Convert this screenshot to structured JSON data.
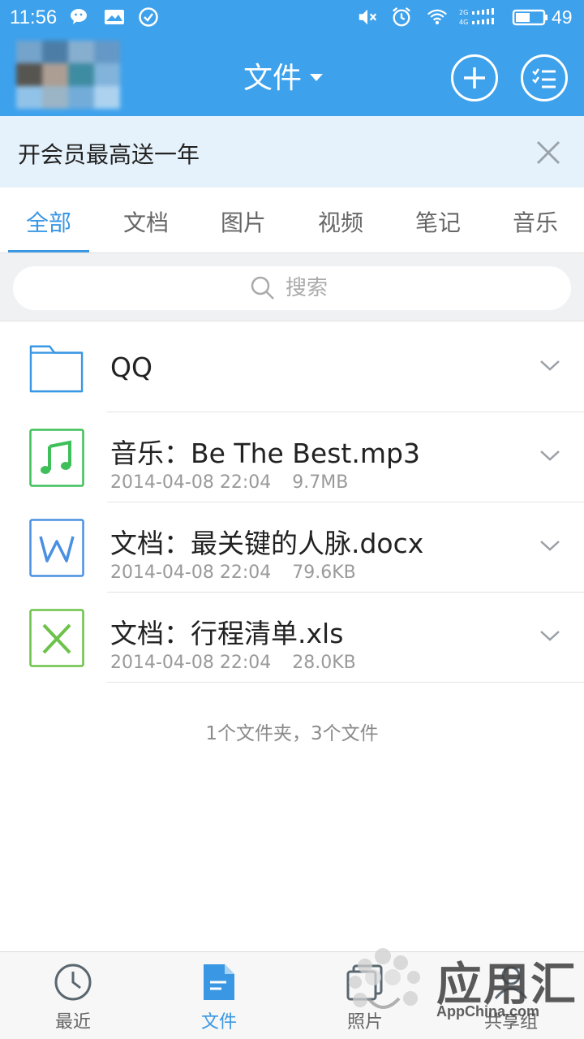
{
  "status_bar": {
    "time": "11:56",
    "battery": "49",
    "network": "2G 4G",
    "icons": [
      "wechat-icon",
      "message-icon",
      "check-circle-icon",
      "mute-icon",
      "alarm-icon",
      "wifi-icon",
      "signal-icon",
      "battery-icon"
    ]
  },
  "header": {
    "title": "文件",
    "add_icon": "plus-circle-icon",
    "select_icon": "multi-select-icon"
  },
  "promo": {
    "text": "开会员最高送一年"
  },
  "tabs": [
    {
      "label": "全部",
      "active": true
    },
    {
      "label": "文档"
    },
    {
      "label": "图片"
    },
    {
      "label": "视频"
    },
    {
      "label": "笔记"
    },
    {
      "label": "音乐"
    }
  ],
  "search": {
    "placeholder": "搜索"
  },
  "files": [
    {
      "name": "QQ",
      "type": "folder",
      "icon": "folder-icon"
    },
    {
      "name": "音乐：Be The Best.mp3",
      "date": "2014-04-08 22:04",
      "size": "9.7MB",
      "icon": "music-note-icon",
      "color": "#3fbf5a"
    },
    {
      "name": "文档：最关键的人脉.docx",
      "date": "2014-04-08 22:04",
      "size": "79.6KB",
      "icon": "word-doc-icon",
      "color": "#4a90e2"
    },
    {
      "name": "文档：行程清单.xls",
      "date": "2014-04-08 22:04",
      "size": "28.0KB",
      "icon": "excel-sheet-icon",
      "color": "#6cc24a"
    }
  ],
  "summary": "1个文件夹，3个文件",
  "bottom_nav": [
    {
      "label": "最近",
      "icon": "clock-icon"
    },
    {
      "label": "文件",
      "icon": "file-icon",
      "active": true
    },
    {
      "label": "照片",
      "icon": "photos-icon"
    },
    {
      "label": "共享组",
      "icon": "group-icon"
    }
  ],
  "watermark": {
    "text": "应用汇",
    "sub": "AppChina.com"
  },
  "colors": {
    "header_blue": "#3da1ec",
    "accent": "#3a97e3",
    "promo_bg": "#e6f2fb"
  }
}
